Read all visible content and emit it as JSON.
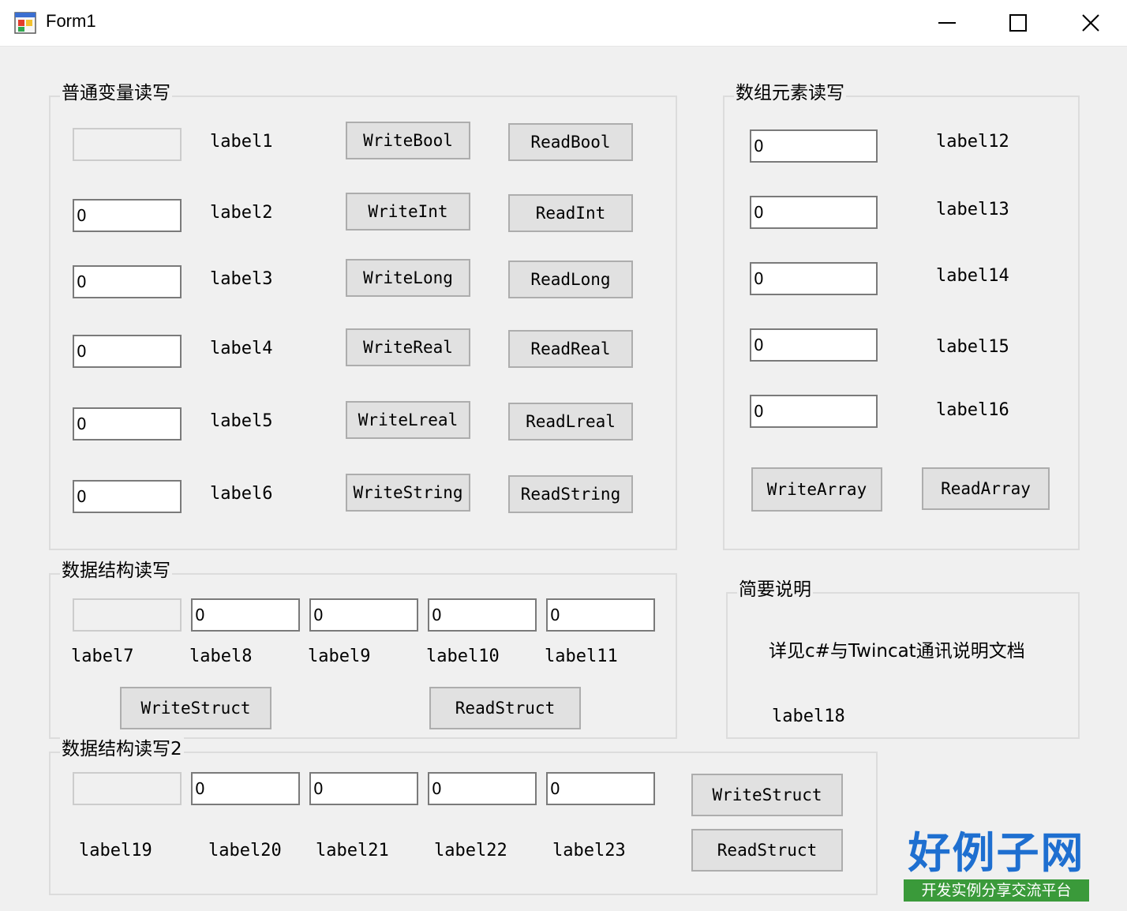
{
  "window": {
    "title": "Form1",
    "controls": [
      "minimize",
      "maximize",
      "close"
    ]
  },
  "group_basic": {
    "title": "普通变量读写",
    "rows": [
      {
        "value": "",
        "label": "label1",
        "write": "WriteBool",
        "read": "ReadBool"
      },
      {
        "value": "0",
        "label": "label2",
        "write": "WriteInt",
        "read": "ReadInt"
      },
      {
        "value": "0",
        "label": "label3",
        "write": "WriteLong",
        "read": "ReadLong"
      },
      {
        "value": "0",
        "label": "label4",
        "write": "WriteReal",
        "read": "ReadReal"
      },
      {
        "value": "0",
        "label": "label5",
        "write": "WriteLreal",
        "read": "ReadLreal"
      },
      {
        "value": "0",
        "label": "label6",
        "write": "WriteString",
        "read": "ReadString"
      }
    ]
  },
  "group_array": {
    "title": "数组元素读写",
    "rows": [
      {
        "value": "0",
        "label": "label12"
      },
      {
        "value": "0",
        "label": "label13"
      },
      {
        "value": "0",
        "label": "label14"
      },
      {
        "value": "0",
        "label": "label15"
      },
      {
        "value": "0",
        "label": "label16"
      }
    ],
    "write": "WriteArray",
    "read": "ReadArray"
  },
  "group_struct": {
    "title": "数据结构读写",
    "fields": [
      {
        "value": "",
        "label": "label7"
      },
      {
        "value": "0",
        "label": "label8"
      },
      {
        "value": "0",
        "label": "label9"
      },
      {
        "value": "0",
        "label": "label10"
      },
      {
        "value": "0",
        "label": "label11"
      }
    ],
    "write": "WriteStruct",
    "read": "ReadStruct"
  },
  "group_desc": {
    "title": "简要说明",
    "text": "详见c#与Twincat通讯说明文档",
    "label": "label18"
  },
  "group_struct2": {
    "title": "数据结构读写2",
    "fields": [
      {
        "value": "",
        "label": "label19"
      },
      {
        "value": "0",
        "label": "label20"
      },
      {
        "value": "0",
        "label": "label21"
      },
      {
        "value": "0",
        "label": "label22"
      },
      {
        "value": "0",
        "label": "label23"
      }
    ],
    "write": "WriteStruct",
    "read": "ReadStruct"
  },
  "watermark": {
    "main": "好例子网",
    "sub": "开发实例分享交流平台"
  }
}
